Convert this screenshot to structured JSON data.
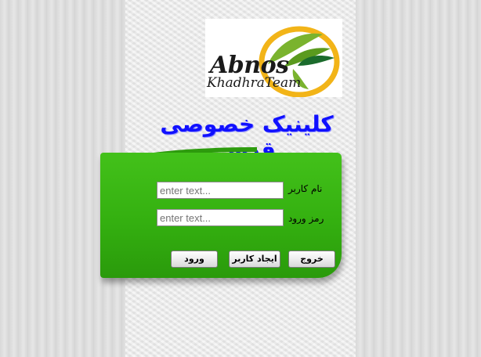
{
  "logo": {
    "title": "Abnos",
    "subtitle": "KhadhraTeam"
  },
  "page": {
    "title": "کلینیک خصوصی قدس"
  },
  "form": {
    "username_label": "نام کاربر",
    "username_placeholder": "enter text...",
    "password_label": "رمز ورود",
    "password_placeholder": "enter text..."
  },
  "buttons": {
    "exit": "خروج",
    "create_user": "ایجاد کاربر",
    "login": "ورود"
  },
  "colors": {
    "panel": "#34b010",
    "title": "#1010ff"
  }
}
